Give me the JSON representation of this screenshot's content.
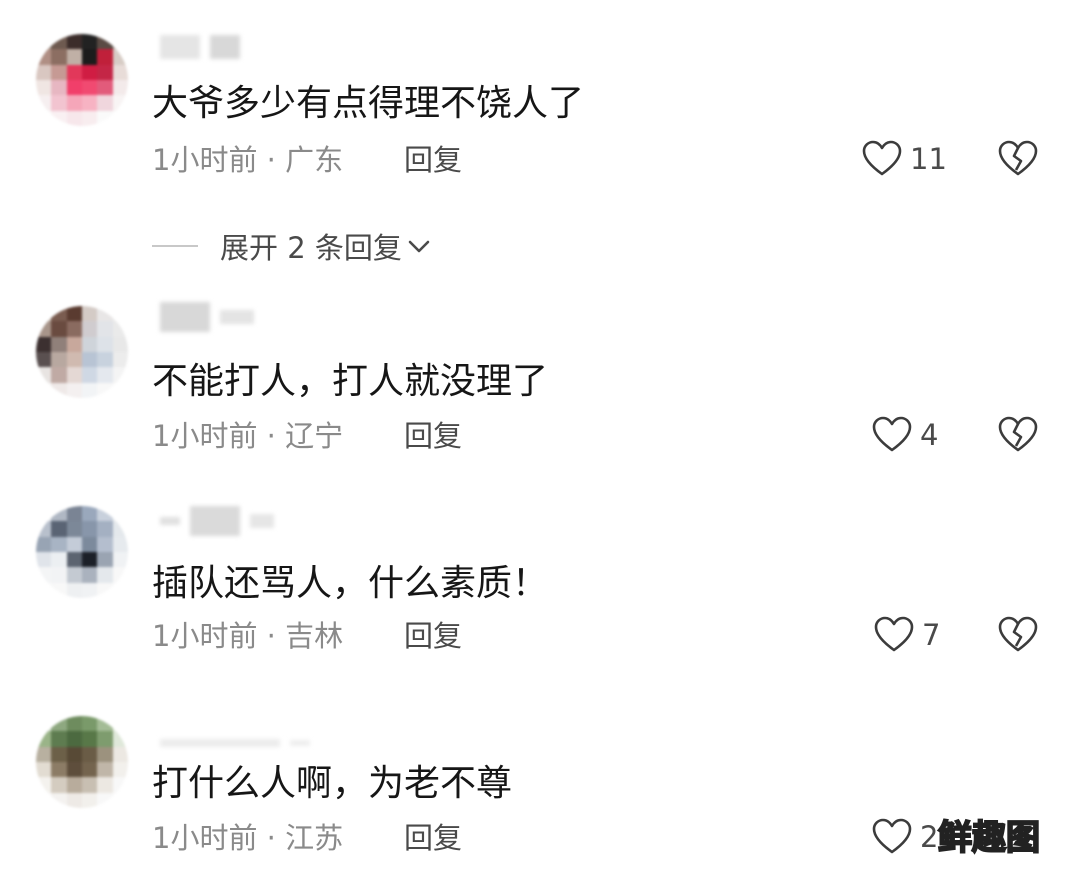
{
  "comments": [
    {
      "text": "大爷多少有点得理不饶人了",
      "time": "1小时前",
      "location": "广东",
      "reply_label": "回复",
      "likes": "11"
    },
    {
      "text": "不能打人，打人就没理了",
      "time": "1小时前",
      "location": "辽宁",
      "reply_label": "回复",
      "likes": "4"
    },
    {
      "text": "插队还骂人，什么素质！",
      "time": "1小时前",
      "location": "吉林",
      "reply_label": "回复",
      "likes": "7"
    },
    {
      "text": "打什么人啊，为老不尊",
      "time": "1小时前",
      "location": "江苏",
      "reply_label": "回复",
      "likes": "2"
    }
  ],
  "expand_replies": {
    "label": "展开 2 条回复"
  },
  "watermark": "鲜趣图",
  "icons": {
    "like": "heart-outline-icon",
    "dislike": "broken-heart-icon",
    "expand": "chevron-down-icon"
  },
  "colors": {
    "text_primary": "#161616",
    "text_meta": "#8a8a8a",
    "text_action": "#4a4a4a"
  }
}
